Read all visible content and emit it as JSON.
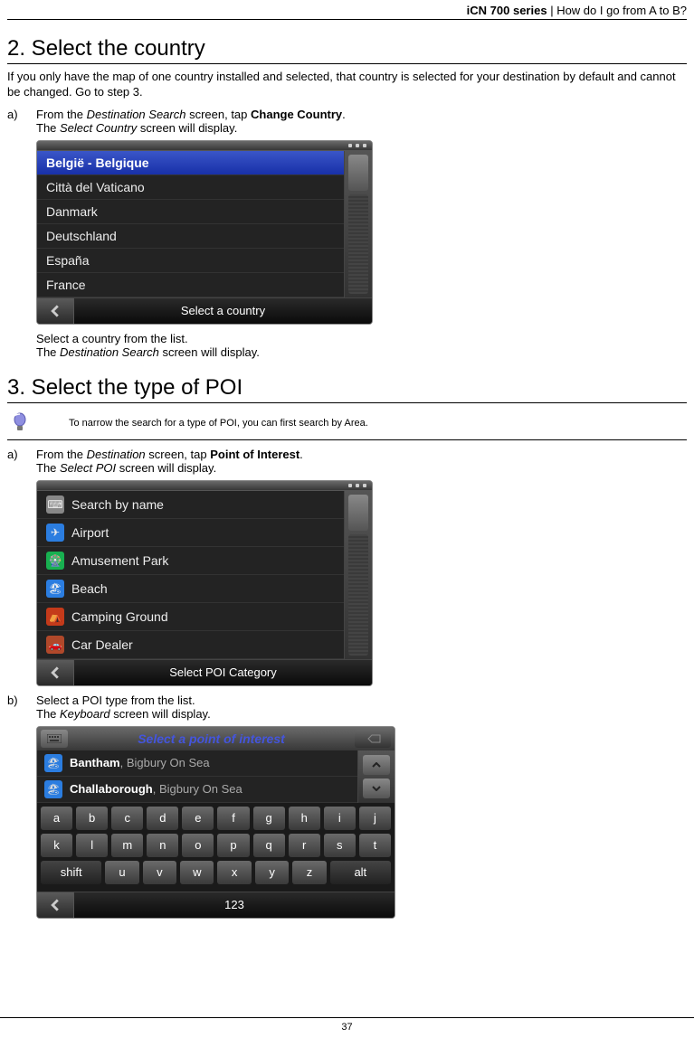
{
  "header": {
    "series": "iCN 700 series",
    "sep": "  |  ",
    "chapter": "How do I go from A to B?"
  },
  "section2": {
    "title": "2. Select the country",
    "intro": "If you only have the map of one country installed and selected, that country is selected for your destination by default and cannot be changed. Go to step 3.",
    "step_a_letter": "a)",
    "step_a_1": "From the ",
    "step_a_em1": "Destination Search",
    "step_a_2": " screen, tap ",
    "step_a_b": "Change Country",
    "step_a_3": ".",
    "step_a_4": "The ",
    "step_a_em2": "Select Country",
    "step_a_5": " screen will display.",
    "after_1": "Select a country from the list.",
    "after_2a": "The ",
    "after_2em": "Destination Search",
    "after_2b": " screen will display."
  },
  "countryScreen": {
    "items": [
      "België - Belgique",
      "Città del Vaticano",
      "Danmark",
      "Deutschland",
      "España",
      "France"
    ],
    "footer": "Select a country"
  },
  "section3": {
    "title": "3. Select the type of POI",
    "tip": "To narrow the search for a type of POI, you can first search by Area.",
    "step_a_letter": "a)",
    "step_a_1": "From the ",
    "step_a_em1": "Destination",
    "step_a_2": " screen, tap ",
    "step_a_b": "Point of Interest",
    "step_a_3": ".",
    "step_a_4": "The ",
    "step_a_em2": "Select POI",
    "step_a_5": " screen will display.",
    "step_b_letter": "b)",
    "step_b_1": "Select a POI type from the list.",
    "step_b_2a": "The ",
    "step_b_2em": "Keyboard",
    "step_b_2b": " screen will display."
  },
  "poiScreen": {
    "items": [
      "Search by name",
      "Airport",
      "Amusement Park",
      "Beach",
      "Camping Ground",
      "Car Dealer"
    ],
    "footer": "Select POI Category"
  },
  "kbdScreen": {
    "title": "Select a point of interest",
    "results": [
      {
        "name": "Bantham",
        "loc": ", Bigbury On Sea"
      },
      {
        "name": "Challaborough",
        "loc": ", Bigbury On Sea"
      }
    ],
    "row1": [
      "a",
      "b",
      "c",
      "d",
      "e",
      "f",
      "g",
      "h",
      "i",
      "j"
    ],
    "row2": [
      "k",
      "l",
      "m",
      "n",
      "o",
      "p",
      "q",
      "r",
      "s",
      "t"
    ],
    "row3": [
      "shift",
      "u",
      "v",
      "w",
      "x",
      "y",
      "z",
      "alt"
    ],
    "numlabel": "123"
  },
  "pageNumber": "37"
}
